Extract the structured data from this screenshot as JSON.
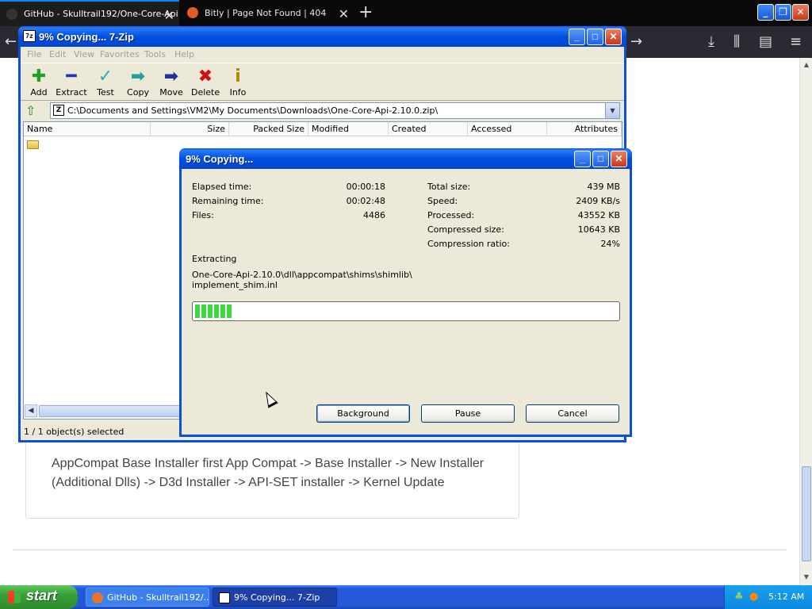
{
  "browser": {
    "tabs": [
      {
        "label": "GitHub - Skulltrail192/One-Core-Api",
        "active": true
      },
      {
        "label": "Bitly | Page Not Found | 404",
        "active": false
      }
    ],
    "page": {
      "text": "AppCompat Base Installer first App Compat -> Base Installer -> New Installer (Additional Dlls) -> D3d Installer -> API-SET installer -> Kernel Update"
    }
  },
  "zip": {
    "title": "9% Copying... 7-Zip",
    "menu": [
      "File",
      "Edit",
      "View",
      "Favorites",
      "Tools",
      "Help"
    ],
    "toolbar": [
      {
        "label": "Add",
        "icon": "plus-icon",
        "color": "#20a020"
      },
      {
        "label": "Extract",
        "icon": "minus-icon",
        "color": "#2030c0"
      },
      {
        "label": "Test",
        "icon": "check-icon",
        "color": "#20b0c0"
      },
      {
        "label": "Copy",
        "icon": "copy-arrow-icon",
        "color": "#20a0a0"
      },
      {
        "label": "Move",
        "icon": "move-arrow-icon",
        "color": "#2030a0"
      },
      {
        "label": "Delete",
        "icon": "delete-x-icon",
        "color": "#d01010"
      },
      {
        "label": "Info",
        "icon": "info-icon",
        "color": "#b08800"
      }
    ],
    "path": "C:\\Documents and Settings\\VM2\\My Documents\\Downloads\\One-Core-Api-2.10.0.zip\\",
    "columns": [
      "Name",
      "Size",
      "Packed Size",
      "Modified",
      "Created",
      "Accessed",
      "Attributes"
    ],
    "status": "1 / 1 object(s) selected"
  },
  "progress": {
    "title": "9% Copying...",
    "left": [
      {
        "label": "Elapsed time:",
        "value": "00:00:18"
      },
      {
        "label": "Remaining time:",
        "value": "00:02:48"
      },
      {
        "label": "Files:",
        "value": "4486"
      }
    ],
    "right": [
      {
        "label": "Total size:",
        "value": "439 MB"
      },
      {
        "label": "Speed:",
        "value": "2409 KB/s"
      },
      {
        "label": "Processed:",
        "value": "43552 KB"
      },
      {
        "label": "Compressed size:",
        "value": "10643 KB"
      },
      {
        "label": "Compression ratio:",
        "value": "24%"
      }
    ],
    "operation": "Extracting",
    "file_line1": "One-Core-Api-2.10.0\\dll\\appcompat\\shims\\shimlib\\",
    "file_line2": "implement_shim.inl",
    "percent": 9,
    "buttons": {
      "background": "Background",
      "pause": "Pause",
      "cancel": "Cancel"
    }
  },
  "taskbar": {
    "start": "start",
    "items": [
      "GitHub - Skulltrail192/...",
      "9% Copying... 7-Zip"
    ],
    "clock": "5:12 AM"
  }
}
